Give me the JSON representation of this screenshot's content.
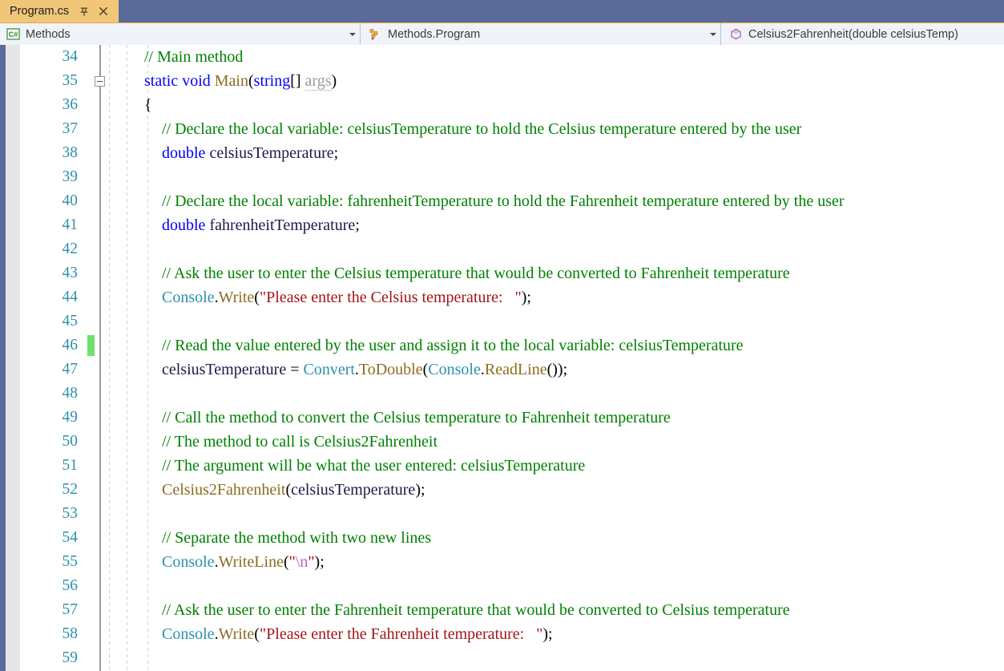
{
  "window": {
    "app": "Visual Studio Code Editor",
    "tab_strip_color": "#5c6b99",
    "active_tab_color": "#f0c678"
  },
  "tabs": [
    {
      "label": "Program.cs",
      "active": true,
      "pin_icon": "pin-icon",
      "close_icon": "close-icon"
    }
  ],
  "navbar": {
    "project_combo": {
      "icon": "csharp-project-icon",
      "value": "Methods",
      "dropdown_icon": "chevron-down-icon"
    },
    "type_combo": {
      "icon": "class-icon",
      "value": "Methods.Program",
      "dropdown_icon": "chevron-down-icon"
    },
    "member_combo": {
      "icon": "method-icon",
      "value": "Celsius2Fahrenheit(double celsiusTemp)",
      "dropdown_icon": "none"
    }
  },
  "editor": {
    "first_visible_line": 34,
    "gutter": {
      "line_number_color": "#2b91af",
      "breakpoint_margin_color": "#e6e6e6"
    },
    "change_bar_color": "#6ee06e",
    "colors": {
      "comment": "#008000",
      "keyword": "#0000ff",
      "method": "#8a6d1e",
      "type": "#2b91af",
      "string": "#a31515",
      "escape": "#c061cb",
      "identifier": "#1a1a4a",
      "parameter_unused": "#9b9b9b"
    },
    "lines": [
      {
        "number": 34,
        "changed": false,
        "fold": false,
        "indent": 180,
        "tokens": [
          {
            "t": "// Main method",
            "c": "tk-comment"
          }
        ]
      },
      {
        "number": 35,
        "changed": false,
        "fold": true,
        "indent": 180,
        "tokens": [
          {
            "t": "static void ",
            "c": "tk-keyword"
          },
          {
            "t": "Main",
            "c": "tk-method"
          },
          {
            "t": "(",
            "c": "tk-punct"
          },
          {
            "t": "string",
            "c": "tk-keyword"
          },
          {
            "t": "[] ",
            "c": "tk-punct"
          },
          {
            "t": "args",
            "c": "tk-param"
          },
          {
            "t": ")",
            "c": "tk-punct"
          }
        ]
      },
      {
        "number": 36,
        "changed": false,
        "fold": false,
        "indent": 180,
        "tokens": [
          {
            "t": "{",
            "c": "tk-punct"
          }
        ]
      },
      {
        "number": 37,
        "changed": false,
        "fold": false,
        "indent": 202,
        "tokens": [
          {
            "t": "// Declare the local variable: celsiusTemperature to hold the Celsius temperature entered by the user",
            "c": "tk-comment"
          }
        ]
      },
      {
        "number": 38,
        "changed": false,
        "fold": false,
        "indent": 202,
        "tokens": [
          {
            "t": "double ",
            "c": "tk-keyword"
          },
          {
            "t": "celsiusTemperature",
            "c": "tk-plain"
          },
          {
            "t": ";",
            "c": "tk-punct"
          }
        ]
      },
      {
        "number": 39,
        "changed": false,
        "fold": false,
        "indent": 202,
        "tokens": []
      },
      {
        "number": 40,
        "changed": false,
        "fold": false,
        "indent": 202,
        "tokens": [
          {
            "t": "// Declare the local variable: fahrenheitTemperature to hold the Fahrenheit temperature entered by the user",
            "c": "tk-comment"
          }
        ]
      },
      {
        "number": 41,
        "changed": false,
        "fold": false,
        "indent": 202,
        "tokens": [
          {
            "t": "double ",
            "c": "tk-keyword"
          },
          {
            "t": "fahrenheitTemperature",
            "c": "tk-plain"
          },
          {
            "t": ";",
            "c": "tk-punct"
          }
        ]
      },
      {
        "number": 42,
        "changed": false,
        "fold": false,
        "indent": 202,
        "tokens": []
      },
      {
        "number": 43,
        "changed": false,
        "fold": false,
        "indent": 202,
        "tokens": [
          {
            "t": "// Ask the user to enter the Celsius temperature that would be converted to Fahrenheit temperature",
            "c": "tk-comment"
          }
        ]
      },
      {
        "number": 44,
        "changed": false,
        "fold": false,
        "indent": 202,
        "tokens": [
          {
            "t": "Console",
            "c": "tk-type"
          },
          {
            "t": ".",
            "c": "tk-punct"
          },
          {
            "t": "Write",
            "c": "tk-method"
          },
          {
            "t": "(",
            "c": "tk-punct"
          },
          {
            "t": "\"Please enter the Celsius temperature:   \"",
            "c": "tk-string"
          },
          {
            "t": ");",
            "c": "tk-punct"
          }
        ]
      },
      {
        "number": 45,
        "changed": false,
        "fold": false,
        "indent": 202,
        "tokens": []
      },
      {
        "number": 46,
        "changed": true,
        "fold": false,
        "indent": 202,
        "tokens": [
          {
            "t": "// Read the value entered by the user and assign it to the local variable: celsiusTemperature",
            "c": "tk-comment"
          }
        ]
      },
      {
        "number": 47,
        "changed": false,
        "fold": false,
        "indent": 202,
        "tokens": [
          {
            "t": "celsiusTemperature",
            "c": "tk-plain"
          },
          {
            "t": " = ",
            "c": "tk-punct"
          },
          {
            "t": "Convert",
            "c": "tk-type"
          },
          {
            "t": ".",
            "c": "tk-punct"
          },
          {
            "t": "ToDouble",
            "c": "tk-method"
          },
          {
            "t": "(",
            "c": "tk-punct"
          },
          {
            "t": "Console",
            "c": "tk-type"
          },
          {
            "t": ".",
            "c": "tk-punct"
          },
          {
            "t": "ReadLine",
            "c": "tk-method"
          },
          {
            "t": "());",
            "c": "tk-punct"
          }
        ]
      },
      {
        "number": 48,
        "changed": false,
        "fold": false,
        "indent": 202,
        "tokens": []
      },
      {
        "number": 49,
        "changed": false,
        "fold": false,
        "indent": 202,
        "tokens": [
          {
            "t": "// Call the method to convert the Celsius temperature to Fahrenheit temperature",
            "c": "tk-comment"
          }
        ]
      },
      {
        "number": 50,
        "changed": false,
        "fold": false,
        "indent": 202,
        "tokens": [
          {
            "t": "// The method to call is Celsius2Fahrenheit",
            "c": "tk-comment"
          }
        ]
      },
      {
        "number": 51,
        "changed": false,
        "fold": false,
        "indent": 202,
        "tokens": [
          {
            "t": "// The argument will be what the user entered: celsiusTemperature",
            "c": "tk-comment"
          }
        ]
      },
      {
        "number": 52,
        "changed": false,
        "fold": false,
        "indent": 202,
        "tokens": [
          {
            "t": "Celsius2Fahrenheit",
            "c": "tk-method"
          },
          {
            "t": "(",
            "c": "tk-punct"
          },
          {
            "t": "celsiusTemperature",
            "c": "tk-plain"
          },
          {
            "t": ");",
            "c": "tk-punct"
          }
        ]
      },
      {
        "number": 53,
        "changed": false,
        "fold": false,
        "indent": 202,
        "tokens": []
      },
      {
        "number": 54,
        "changed": false,
        "fold": false,
        "indent": 202,
        "tokens": [
          {
            "t": "// Separate the method with two new lines",
            "c": "tk-comment"
          }
        ]
      },
      {
        "number": 55,
        "changed": false,
        "fold": false,
        "indent": 202,
        "tokens": [
          {
            "t": "Console",
            "c": "tk-type"
          },
          {
            "t": ".",
            "c": "tk-punct"
          },
          {
            "t": "WriteLine",
            "c": "tk-method"
          },
          {
            "t": "(",
            "c": "tk-punct"
          },
          {
            "t": "\"",
            "c": "tk-string"
          },
          {
            "t": "\\n",
            "c": "tk-escape"
          },
          {
            "t": "\"",
            "c": "tk-string"
          },
          {
            "t": ");",
            "c": "tk-punct"
          }
        ]
      },
      {
        "number": 56,
        "changed": false,
        "fold": false,
        "indent": 202,
        "tokens": []
      },
      {
        "number": 57,
        "changed": false,
        "fold": false,
        "indent": 202,
        "tokens": [
          {
            "t": "// Ask the user to enter the Fahrenheit temperature that would be converted to Celsius temperature",
            "c": "tk-comment"
          }
        ]
      },
      {
        "number": 58,
        "changed": false,
        "fold": false,
        "indent": 202,
        "tokens": [
          {
            "t": "Console",
            "c": "tk-type"
          },
          {
            "t": ".",
            "c": "tk-punct"
          },
          {
            "t": "Write",
            "c": "tk-method"
          },
          {
            "t": "(",
            "c": "tk-punct"
          },
          {
            "t": "\"Please enter the Fahrenheit temperature:   \"",
            "c": "tk-string"
          },
          {
            "t": ");",
            "c": "tk-punct"
          }
        ]
      },
      {
        "number": 59,
        "changed": false,
        "fold": false,
        "indent": 202,
        "tokens": []
      }
    ],
    "indent_guides_x": [
      136,
      158,
      184
    ]
  }
}
